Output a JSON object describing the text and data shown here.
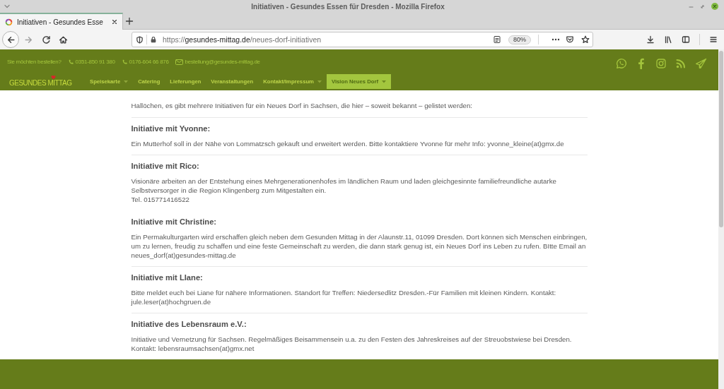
{
  "window": {
    "title": "Initiativen - Gesundes Essen für Dresden - Mozilla Firefox"
  },
  "tabs": [
    {
      "label": "Initiativen - Gesundes Esse",
      "selected": true
    }
  ],
  "address_bar": {
    "url": "https://**gesundes-mittag.de**/neues-dorf-initiativen",
    "zoom": "80%"
  },
  "site_header": {
    "order_prompt": "Sie möchten bestellen?",
    "contacts": [
      {
        "kind": "phone",
        "text": "0351-850 91 380"
      },
      {
        "kind": "phone",
        "text": "0176-604 66 876"
      },
      {
        "kind": "email",
        "text": "bestellung@gesundes-mittag.de"
      }
    ],
    "logo": "GESUNDES MITTAG",
    "nav": [
      {
        "label": "Speisekarte",
        "dropdown": true,
        "selected": false
      },
      {
        "label": "Catering",
        "dropdown": false,
        "selected": false
      },
      {
        "label": "Lieferungen",
        "dropdown": false,
        "selected": false
      },
      {
        "label": "Veranstaltungen",
        "dropdown": false,
        "selected": false
      },
      {
        "label": "Kontakt/Impressum",
        "dropdown": true,
        "selected": false
      },
      {
        "label": "Vision Neues Dorf",
        "dropdown": true,
        "selected": true
      }
    ]
  },
  "content": {
    "intro": "Hallöchen, es gibt mehrere Initiativen für ein Neues Dorf in Sachsen, die hier – soweit bekannt – gelistet werden:",
    "initiatives": [
      {
        "heading": "Initiative mit Yvonne:",
        "separated": true,
        "lines": [
          "Ein Mutterhof soll in der Nähe von Lommatzsch gekauft und erweitert werden. Bitte kontaktiere Yvonne für mehr Info: yvonne_kleine(at)gmx.de"
        ]
      },
      {
        "heading": "Initiative mit Rico:",
        "separated": true,
        "lines": [
          "Visionäre arbeiten an der Entstehung eines Mehrgenerationenhofes im ländlichen Raum und laden gleichgesinnte familiefreundliche autarke",
          "Selbstversorger in die Region Klingenberg zum Mitgestalten ein.",
          "Tel. 015771416522"
        ]
      },
      {
        "heading": "Initiative mit Christine:",
        "separated": false,
        "lines": [
          "Ein Permakulturgarten wird erschaffen gleich neben dem Gesunden Mittag in der Alaunstr.11, 01099 Dresden. Dort können sich Menschen einbringen,",
          "um zu lernen, freudig zu schaffen und eine feste Gemeinschaft zu werden, die dann stark genug ist, ein Neues Dorf ins Leben zu rufen. BItte Email an",
          "neues_dorf(at)gesundes-mittag.de"
        ]
      },
      {
        "heading": "Initiative mit LIane:",
        "separated": true,
        "lines": [
          "Bitte meldet euch bei Liane für nähere Informationen. Standort für Treffen: Niedersedlitz Dresden.-Für Familien mit kleinen Kindern. Kontakt:",
          "jule.leser(at)hochgruen.de"
        ]
      },
      {
        "heading": "Initiative des Lebensraum e.V.:",
        "separated": true,
        "lines": [
          "Initiative und Vernetzung für Sachsen. Regelmäßiges Beisammensein u.a. zu den Festen des Jahreskreises auf der Streuobstwiese bei Dresden.",
          "Kontakt: lebensraumsachsen(at)gmx.net"
        ]
      }
    ]
  }
}
